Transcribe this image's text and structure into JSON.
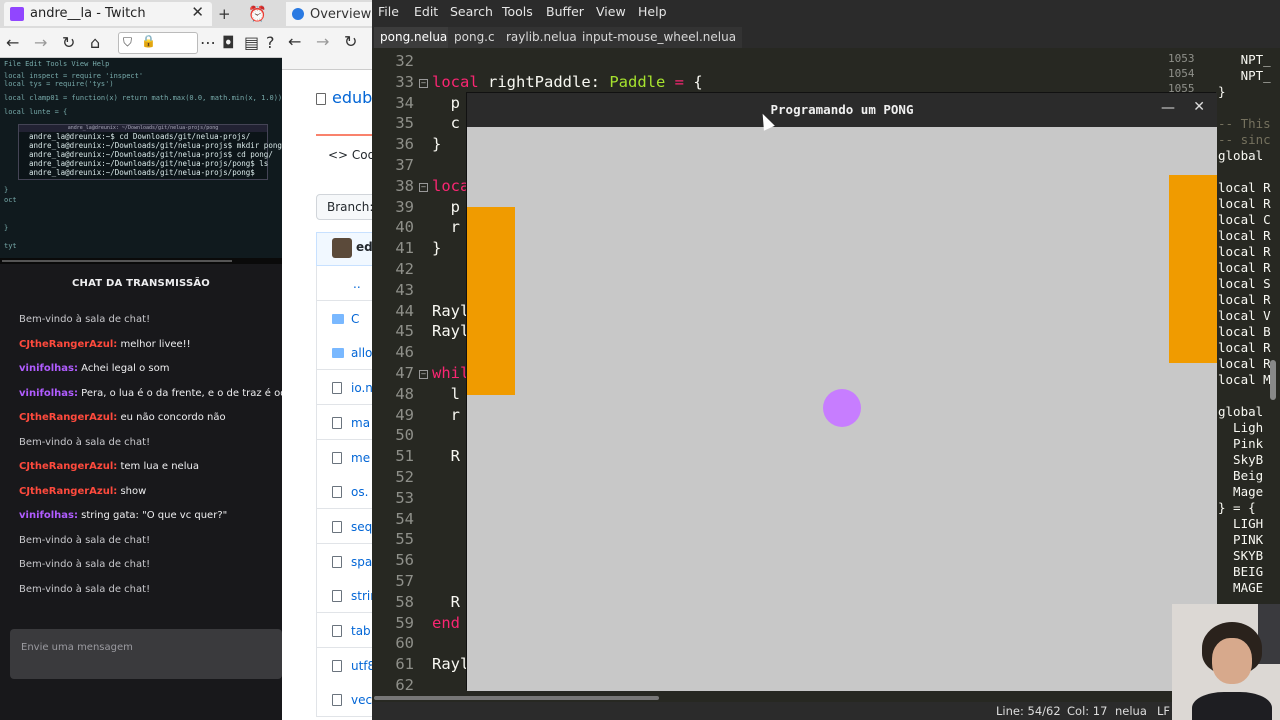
{
  "twitch": {
    "tab_title": "andre__la - Twitch",
    "chat_title": "CHAT DA TRANSMISSÃO",
    "chat_input_placeholder": "Envie uma mensagem",
    "terminal_lines": [
      "andre_la@dreunix:~$ cd Downloads/git/nelua-projs/",
      "andre_la@dreunix:~/Downloads/git/nelua-projs$ mkdir pong",
      "andre_la@dreunix:~/Downloads/git/nelua-projs$ cd pong/",
      "andre_la@dreunix:~/Downloads/git/nelua-projs/pong$ ls",
      "andre_la@dreunix:~/Downloads/git/nelua-projs/pong$"
    ],
    "chat": [
      {
        "user": "",
        "text": "Bem-vindo à sala de chat!",
        "color": "#c8c8cc"
      },
      {
        "user": "CJtheRangerAzul:",
        "text": " melhor livee!!",
        "color": "#ff4a3d"
      },
      {
        "user": "vinifolhas:",
        "text": " Achei legal o som",
        "color": "#b05cff"
      },
      {
        "user": "vinifolhas:",
        "text": " Pera, o lua é o da frente, e o de traz é oq?",
        "color": "#b05cff"
      },
      {
        "user": "CJtheRangerAzul:",
        "text": " eu não concordo não",
        "color": "#ff4a3d"
      },
      {
        "user": "",
        "text": "Bem-vindo à sala de chat!",
        "color": "#c8c8cc"
      },
      {
        "user": "CJtheRangerAzul:",
        "text": " tem lua e nelua",
        "color": "#ff4a3d"
      },
      {
        "user": "CJtheRangerAzul:",
        "text": " show",
        "color": "#ff4a3d"
      },
      {
        "user": "vinifolhas:",
        "text": " string gata: \"O que vc quer?\"",
        "color": "#b05cff"
      },
      {
        "user": "",
        "text": "Bem-vindo à sala de chat!",
        "color": "#c8c8cc"
      },
      {
        "user": "",
        "text": "Bem-vindo à sala de chat!",
        "color": "#c8c8cc"
      },
      {
        "user": "",
        "text": "Bem-vindo à sala de chat!",
        "color": "#c8c8cc"
      }
    ]
  },
  "github": {
    "tab_title": "Overview",
    "repo": "eduba",
    "code_tab": "<> Cod",
    "branch": "Branch: r",
    "commit_user": "ed",
    "files": [
      {
        "name": "..",
        "type": "up"
      },
      {
        "name": "C",
        "type": "dir"
      },
      {
        "name": "allo",
        "type": "dir"
      },
      {
        "name": "io.n",
        "type": "file"
      },
      {
        "name": "ma",
        "type": "file"
      },
      {
        "name": "me",
        "type": "file"
      },
      {
        "name": "os.",
        "type": "file"
      },
      {
        "name": "seq",
        "type": "file"
      },
      {
        "name": "spa",
        "type": "file"
      },
      {
        "name": "strin",
        "type": "file"
      },
      {
        "name": "tab",
        "type": "file"
      },
      {
        "name": "utf8",
        "type": "file"
      },
      {
        "name": "vec",
        "type": "file"
      }
    ]
  },
  "editor": {
    "menu": [
      "File",
      "Edit",
      "Search",
      "Tools",
      "Buffer",
      "View",
      "Help"
    ],
    "tabs": [
      "pong.nelua",
      "pong.c",
      "raylib.nelua",
      "input-mouse_wheel.nelua"
    ],
    "active_tab": "pong.nelua",
    "lines": [
      {
        "n": "32",
        "t": ""
      },
      {
        "n": "33",
        "t": "local rightPaddle: Paddle = {"
      },
      {
        "n": "34",
        "t": "  p"
      },
      {
        "n": "35",
        "t": "  c"
      },
      {
        "n": "36",
        "t": "}"
      },
      {
        "n": "37",
        "t": ""
      },
      {
        "n": "38",
        "t": "loca"
      },
      {
        "n": "39",
        "t": "  p"
      },
      {
        "n": "40",
        "t": "  r"
      },
      {
        "n": "41",
        "t": "}"
      },
      {
        "n": "42",
        "t": ""
      },
      {
        "n": "43",
        "t": ""
      },
      {
        "n": "44",
        "t": "Rayl"
      },
      {
        "n": "45",
        "t": "Rayl"
      },
      {
        "n": "46",
        "t": ""
      },
      {
        "n": "47",
        "t": "whil"
      },
      {
        "n": "48",
        "t": "  l"
      },
      {
        "n": "49",
        "t": "  r"
      },
      {
        "n": "50",
        "t": ""
      },
      {
        "n": "51",
        "t": "  R"
      },
      {
        "n": "52",
        "t": ""
      },
      {
        "n": "53",
        "t": ""
      },
      {
        "n": "54",
        "t": ""
      },
      {
        "n": "55",
        "t": ""
      },
      {
        "n": "56",
        "t": ""
      },
      {
        "n": "57",
        "t": ""
      },
      {
        "n": "58",
        "t": "  R"
      },
      {
        "n": "59",
        "t": "end"
      },
      {
        "n": "60",
        "t": ""
      },
      {
        "n": "61",
        "t": "Rayl"
      },
      {
        "n": "62",
        "t": ""
      }
    ],
    "minimap_nums": [
      "1053",
      "1054",
      "1055"
    ],
    "minimap": [
      "   NPT_",
      "   NPT_",
      "}",
      "",
      "-- This",
      "-- sinc",
      "global ",
      "",
      "local R",
      "local R",
      "local C",
      "local R",
      "local R",
      "local R",
      "local S",
      "local R",
      "local V",
      "local B",
      "local R",
      "local R",
      "local M",
      "",
      "global ",
      "  Ligh",
      "  Pink",
      "  SkyB",
      "  Beig",
      "  Mage",
      "} = {",
      "  LIGH",
      "  PINK",
      "  SKYB",
      "  BEIG",
      "  MAGE"
    ],
    "status": {
      "line": "Line: 54/62",
      "col": "Col: 17",
      "lang": "nelua",
      "eol": "LF"
    }
  },
  "pong": {
    "title": "Programando um PONG",
    "min_icon": "minimize-icon",
    "close_icon": "close-icon",
    "colors": {
      "background": "#c8c8c8",
      "paddle": "#f09b00",
      "ball": "#c77dff"
    }
  }
}
